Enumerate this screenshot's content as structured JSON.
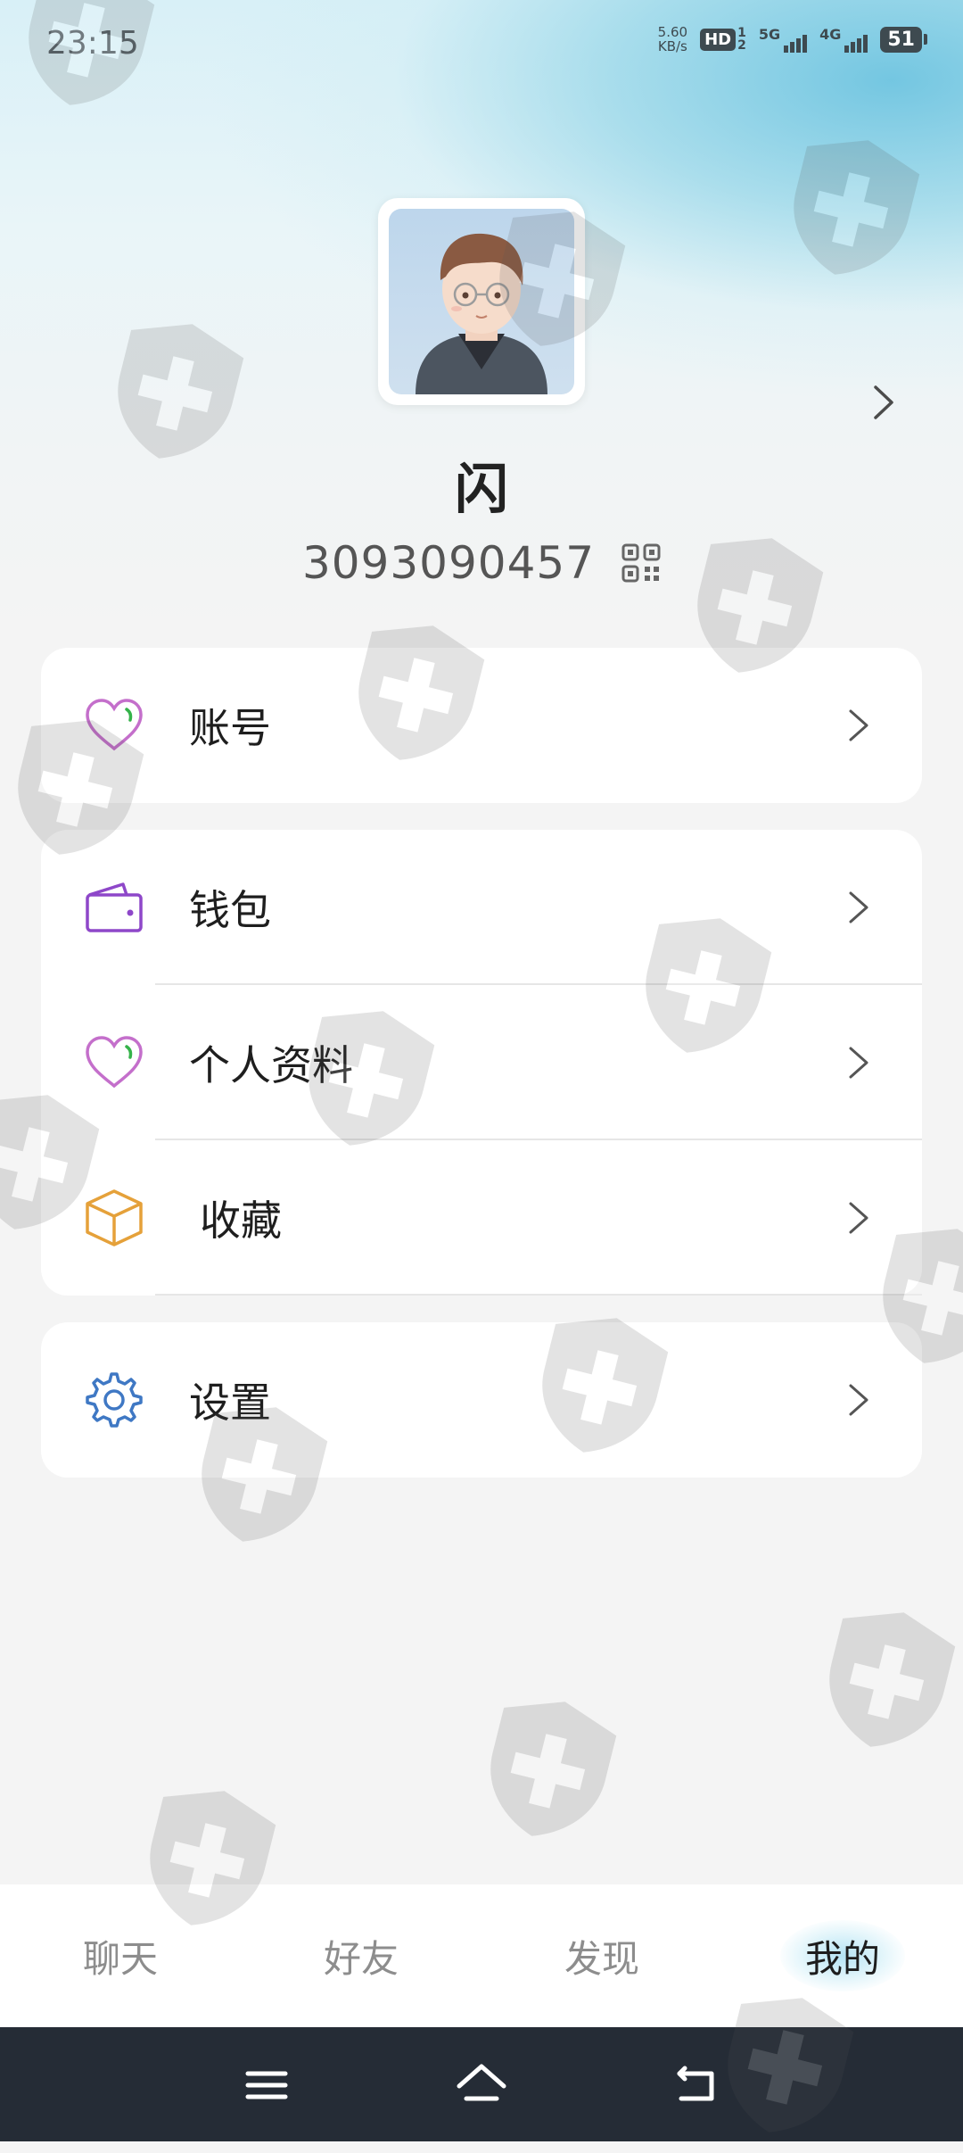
{
  "status_bar": {
    "time": "23:15",
    "net_speed_value": "5.60",
    "net_speed_unit": "KB/s",
    "hd_label": "HD",
    "hd_sub_top": "1",
    "hd_sub_bottom": "2",
    "sig1_label": "5G",
    "sig2_label": "4G",
    "battery": "51"
  },
  "profile": {
    "nickname": "闪",
    "user_id": "3093090457"
  },
  "menu": {
    "account_label": "账号",
    "wallet_label": "钱包",
    "profile_info_label": "个人资料",
    "favorites_label": "收藏",
    "settings_label": "设置"
  },
  "bottom_nav": {
    "items": [
      {
        "label": "聊天"
      },
      {
        "label": "好友"
      },
      {
        "label": "发现"
      },
      {
        "label": "我的"
      }
    ],
    "active_index": 3
  },
  "colors": {
    "heart": "#c46fcb",
    "heart_accent": "#35b34a",
    "wallet": "#8e47c9",
    "box": "#e5a13a",
    "gear": "#3f78c4"
  }
}
